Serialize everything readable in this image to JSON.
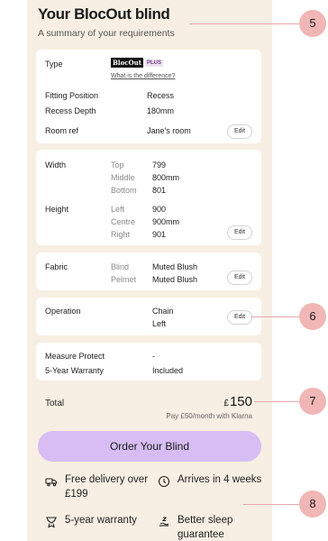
{
  "header": {
    "title": "Your BlocOut blind",
    "subtitle": "A summary of your requirements"
  },
  "type_card": {
    "type_label": "Type",
    "logo_text": "BlocOut",
    "logo_badge": "PLUS",
    "diff_link": "What is the difference?",
    "fitting_label": "Fitting Position",
    "fitting_value": "Recess",
    "depth_label": "Recess Depth",
    "depth_value": "180mm",
    "room_label": "Room ref",
    "room_value": "Jane's room",
    "edit": "Edit"
  },
  "size_card": {
    "width_label": "Width",
    "width_rows": [
      {
        "pos": "Top",
        "value": "799"
      },
      {
        "pos": "Middle",
        "value": "800mm"
      },
      {
        "pos": "Bottom",
        "value": "801"
      }
    ],
    "height_label": "Height",
    "height_rows": [
      {
        "pos": "Left",
        "value": "900"
      },
      {
        "pos": "Centre",
        "value": "900mm"
      },
      {
        "pos": "Right",
        "value": "901"
      }
    ],
    "edit": "Edit"
  },
  "fabric_card": {
    "label": "Fabric",
    "rows": [
      {
        "pos": "Blind",
        "value": "Muted Blush"
      },
      {
        "pos": "Pelmet",
        "value": "Muted Blush"
      }
    ],
    "edit": "Edit"
  },
  "operation_card": {
    "label": "Operation",
    "value1": "Chain",
    "value2": "Left",
    "edit": "Edit"
  },
  "extras_card": {
    "protect_label": "Measure Protect",
    "protect_value": "-",
    "warranty_label": "5-Year Warranty",
    "warranty_value": "Included"
  },
  "total": {
    "label": "Total",
    "currency": "£",
    "amount": "150",
    "klarna": "Pay £50/month with Klarna"
  },
  "order_button": "Order Your Blind",
  "features": [
    {
      "icon": "delivery-van-icon",
      "text": "Free delivery over £199"
    },
    {
      "icon": "clock-icon",
      "text": "Arrives in 4 weeks"
    },
    {
      "icon": "award-ribbon-icon",
      "text": "5-year warranty"
    },
    {
      "icon": "sleep-icon",
      "text": "Better sleep guarantee"
    }
  ],
  "callouts": [
    "5",
    "6",
    "7",
    "8"
  ],
  "colors": {
    "panel_bg": "#f7efe3",
    "order_button": "#d7bdf3",
    "callout": "#f1b6b6"
  }
}
